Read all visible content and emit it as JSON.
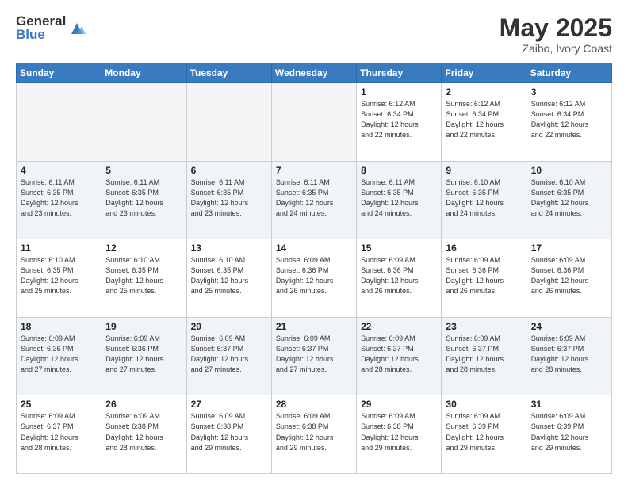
{
  "header": {
    "logo_general": "General",
    "logo_blue": "Blue",
    "month_title": "May 2025",
    "location": "Zaibo, Ivory Coast"
  },
  "weekdays": [
    "Sunday",
    "Monday",
    "Tuesday",
    "Wednesday",
    "Thursday",
    "Friday",
    "Saturday"
  ],
  "weeks": [
    [
      {
        "day": "",
        "info": ""
      },
      {
        "day": "",
        "info": ""
      },
      {
        "day": "",
        "info": ""
      },
      {
        "day": "",
        "info": ""
      },
      {
        "day": "1",
        "info": "Sunrise: 6:12 AM\nSunset: 6:34 PM\nDaylight: 12 hours\nand 22 minutes."
      },
      {
        "day": "2",
        "info": "Sunrise: 6:12 AM\nSunset: 6:34 PM\nDaylight: 12 hours\nand 22 minutes."
      },
      {
        "day": "3",
        "info": "Sunrise: 6:12 AM\nSunset: 6:34 PM\nDaylight: 12 hours\nand 22 minutes."
      }
    ],
    [
      {
        "day": "4",
        "info": "Sunrise: 6:11 AM\nSunset: 6:35 PM\nDaylight: 12 hours\nand 23 minutes."
      },
      {
        "day": "5",
        "info": "Sunrise: 6:11 AM\nSunset: 6:35 PM\nDaylight: 12 hours\nand 23 minutes."
      },
      {
        "day": "6",
        "info": "Sunrise: 6:11 AM\nSunset: 6:35 PM\nDaylight: 12 hours\nand 23 minutes."
      },
      {
        "day": "7",
        "info": "Sunrise: 6:11 AM\nSunset: 6:35 PM\nDaylight: 12 hours\nand 24 minutes."
      },
      {
        "day": "8",
        "info": "Sunrise: 6:11 AM\nSunset: 6:35 PM\nDaylight: 12 hours\nand 24 minutes."
      },
      {
        "day": "9",
        "info": "Sunrise: 6:10 AM\nSunset: 6:35 PM\nDaylight: 12 hours\nand 24 minutes."
      },
      {
        "day": "10",
        "info": "Sunrise: 6:10 AM\nSunset: 6:35 PM\nDaylight: 12 hours\nand 24 minutes."
      }
    ],
    [
      {
        "day": "11",
        "info": "Sunrise: 6:10 AM\nSunset: 6:35 PM\nDaylight: 12 hours\nand 25 minutes."
      },
      {
        "day": "12",
        "info": "Sunrise: 6:10 AM\nSunset: 6:35 PM\nDaylight: 12 hours\nand 25 minutes."
      },
      {
        "day": "13",
        "info": "Sunrise: 6:10 AM\nSunset: 6:35 PM\nDaylight: 12 hours\nand 25 minutes."
      },
      {
        "day": "14",
        "info": "Sunrise: 6:09 AM\nSunset: 6:36 PM\nDaylight: 12 hours\nand 26 minutes."
      },
      {
        "day": "15",
        "info": "Sunrise: 6:09 AM\nSunset: 6:36 PM\nDaylight: 12 hours\nand 26 minutes."
      },
      {
        "day": "16",
        "info": "Sunrise: 6:09 AM\nSunset: 6:36 PM\nDaylight: 12 hours\nand 26 minutes."
      },
      {
        "day": "17",
        "info": "Sunrise: 6:09 AM\nSunset: 6:36 PM\nDaylight: 12 hours\nand 26 minutes."
      }
    ],
    [
      {
        "day": "18",
        "info": "Sunrise: 6:09 AM\nSunset: 6:36 PM\nDaylight: 12 hours\nand 27 minutes."
      },
      {
        "day": "19",
        "info": "Sunrise: 6:09 AM\nSunset: 6:36 PM\nDaylight: 12 hours\nand 27 minutes."
      },
      {
        "day": "20",
        "info": "Sunrise: 6:09 AM\nSunset: 6:37 PM\nDaylight: 12 hours\nand 27 minutes."
      },
      {
        "day": "21",
        "info": "Sunrise: 6:09 AM\nSunset: 6:37 PM\nDaylight: 12 hours\nand 27 minutes."
      },
      {
        "day": "22",
        "info": "Sunrise: 6:09 AM\nSunset: 6:37 PM\nDaylight: 12 hours\nand 28 minutes."
      },
      {
        "day": "23",
        "info": "Sunrise: 6:09 AM\nSunset: 6:37 PM\nDaylight: 12 hours\nand 28 minutes."
      },
      {
        "day": "24",
        "info": "Sunrise: 6:09 AM\nSunset: 6:37 PM\nDaylight: 12 hours\nand 28 minutes."
      }
    ],
    [
      {
        "day": "25",
        "info": "Sunrise: 6:09 AM\nSunset: 6:37 PM\nDaylight: 12 hours\nand 28 minutes."
      },
      {
        "day": "26",
        "info": "Sunrise: 6:09 AM\nSunset: 6:38 PM\nDaylight: 12 hours\nand 28 minutes."
      },
      {
        "day": "27",
        "info": "Sunrise: 6:09 AM\nSunset: 6:38 PM\nDaylight: 12 hours\nand 29 minutes."
      },
      {
        "day": "28",
        "info": "Sunrise: 6:09 AM\nSunset: 6:38 PM\nDaylight: 12 hours\nand 29 minutes."
      },
      {
        "day": "29",
        "info": "Sunrise: 6:09 AM\nSunset: 6:38 PM\nDaylight: 12 hours\nand 29 minutes."
      },
      {
        "day": "30",
        "info": "Sunrise: 6:09 AM\nSunset: 6:39 PM\nDaylight: 12 hours\nand 29 minutes."
      },
      {
        "day": "31",
        "info": "Sunrise: 6:09 AM\nSunset: 6:39 PM\nDaylight: 12 hours\nand 29 minutes."
      }
    ]
  ]
}
